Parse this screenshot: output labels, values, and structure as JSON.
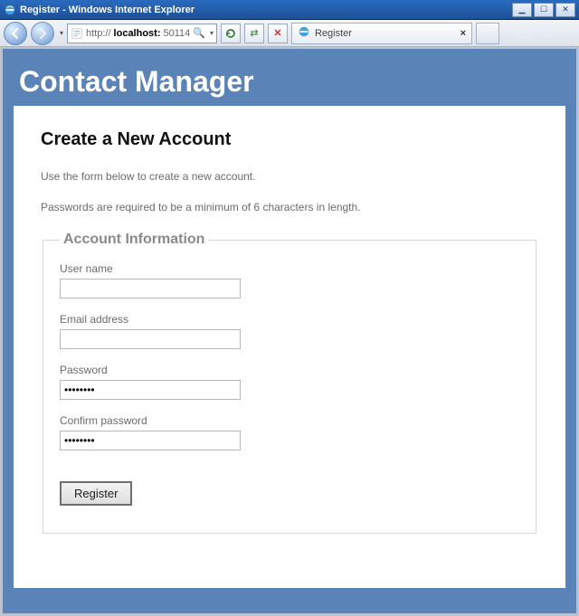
{
  "window": {
    "title": "Register - Windows Internet Explorer"
  },
  "toolbar": {
    "url_prefix": "http://",
    "url_host": "localhost:",
    "url_port": "50114",
    "tab_label": "Register"
  },
  "page": {
    "brand": "Contact Manager",
    "heading": "Create a New Account",
    "intro": "Use the form below to create a new account.",
    "pw_note": "Passwords are required to be a minimum of 6 characters in length.",
    "legend": "Account Information",
    "labels": {
      "username": "User name",
      "email": "Email address",
      "password": "Password",
      "confirm": "Confirm password"
    },
    "values": {
      "username": "",
      "email": "",
      "password": "••••••••",
      "confirm": "••••••••"
    },
    "submit": "Register"
  }
}
